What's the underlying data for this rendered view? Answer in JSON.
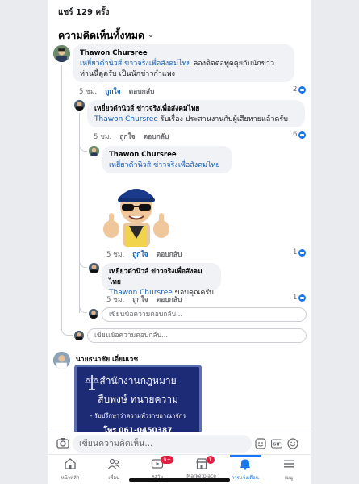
{
  "header": {
    "shares": "แชร์ 129 ครั้ง",
    "all_comments": "ความคิดเห็นทั้งหมด"
  },
  "comments": [
    {
      "name": "Thawon Chursree",
      "tag": "เหยี่ยวดำนิวส์ ข่าวจริงเพื่อสังคมไทย",
      "text": " ลองติดต่อพูดคุยกับนักข่าวท่านนี้ดูครับ เป็นนักข่าวกำแพง",
      "time": "5 ชม.",
      "like": "ถูกใจ",
      "reply": "ตอบกลับ",
      "reactions": "2"
    },
    {
      "name": "เหยี่ยวดำนิวส์ ข่าวจริงเพื่อสังคมไทย",
      "tag": "Thawon Chursree",
      "text": " รับเรื่อง ประสานงานกับผู้เสียหายแล้วครับ",
      "time": "5 ชม.",
      "like": "ถูกใจ",
      "reply": "ตอบกลับ",
      "reactions": "6"
    },
    {
      "name": "Thawon Chursree",
      "tag": "เหยี่ยวดำนิวส์ ข่าวจริงเพื่อสังคมไทย",
      "time": "5 ชม.",
      "like": "ถูกใจ",
      "reply": "ตอบกลับ",
      "reactions": "1"
    },
    {
      "name": "เหยี่ยวดำนิวส์ ข่าวจริงเพื่อสังคมไทย",
      "tag": "Thawon Chursree",
      "text": " ขอบคุณครับ",
      "time": "5 ชม.",
      "like": "ถูกใจ",
      "reply": "ตอบกลับ",
      "reactions": "1"
    }
  ],
  "reply_placeholder_inner": "เขียนข้อความตอบกลับ...",
  "reply_placeholder_outer": "เขียนข้อความตอบกลับ...",
  "next_comment": {
    "name": "นายธนาชัย เอี่ยมเวช",
    "ad_line1": "สำนักงานกฎหมาย",
    "ad_line2": "สืบพงษ์ ทนายความ",
    "ad_line3": "- รับปรึกษาว่าความทั่วราชอาณาจักร",
    "ad_line4": "โทร 061-0450387"
  },
  "compose": {
    "placeholder": "เขียนความคิดเห็น..."
  },
  "tabbar": {
    "items": [
      {
        "label": "หน้าหลัก",
        "icon": "home-icon"
      },
      {
        "label": "เพื่อน",
        "icon": "friends-icon"
      },
      {
        "label": "วิดีโอ",
        "icon": "video-icon",
        "badge": "9+"
      },
      {
        "label": "Marketplace",
        "icon": "marketplace-icon",
        "badge": "1"
      },
      {
        "label": "การแจ้งเตือน",
        "icon": "bell-icon"
      },
      {
        "label": "เมนู",
        "icon": "menu-icon"
      }
    ]
  },
  "colors": {
    "accent": "#1877f2",
    "link": "#1a5fb4",
    "bubble": "#f0f2f5"
  }
}
